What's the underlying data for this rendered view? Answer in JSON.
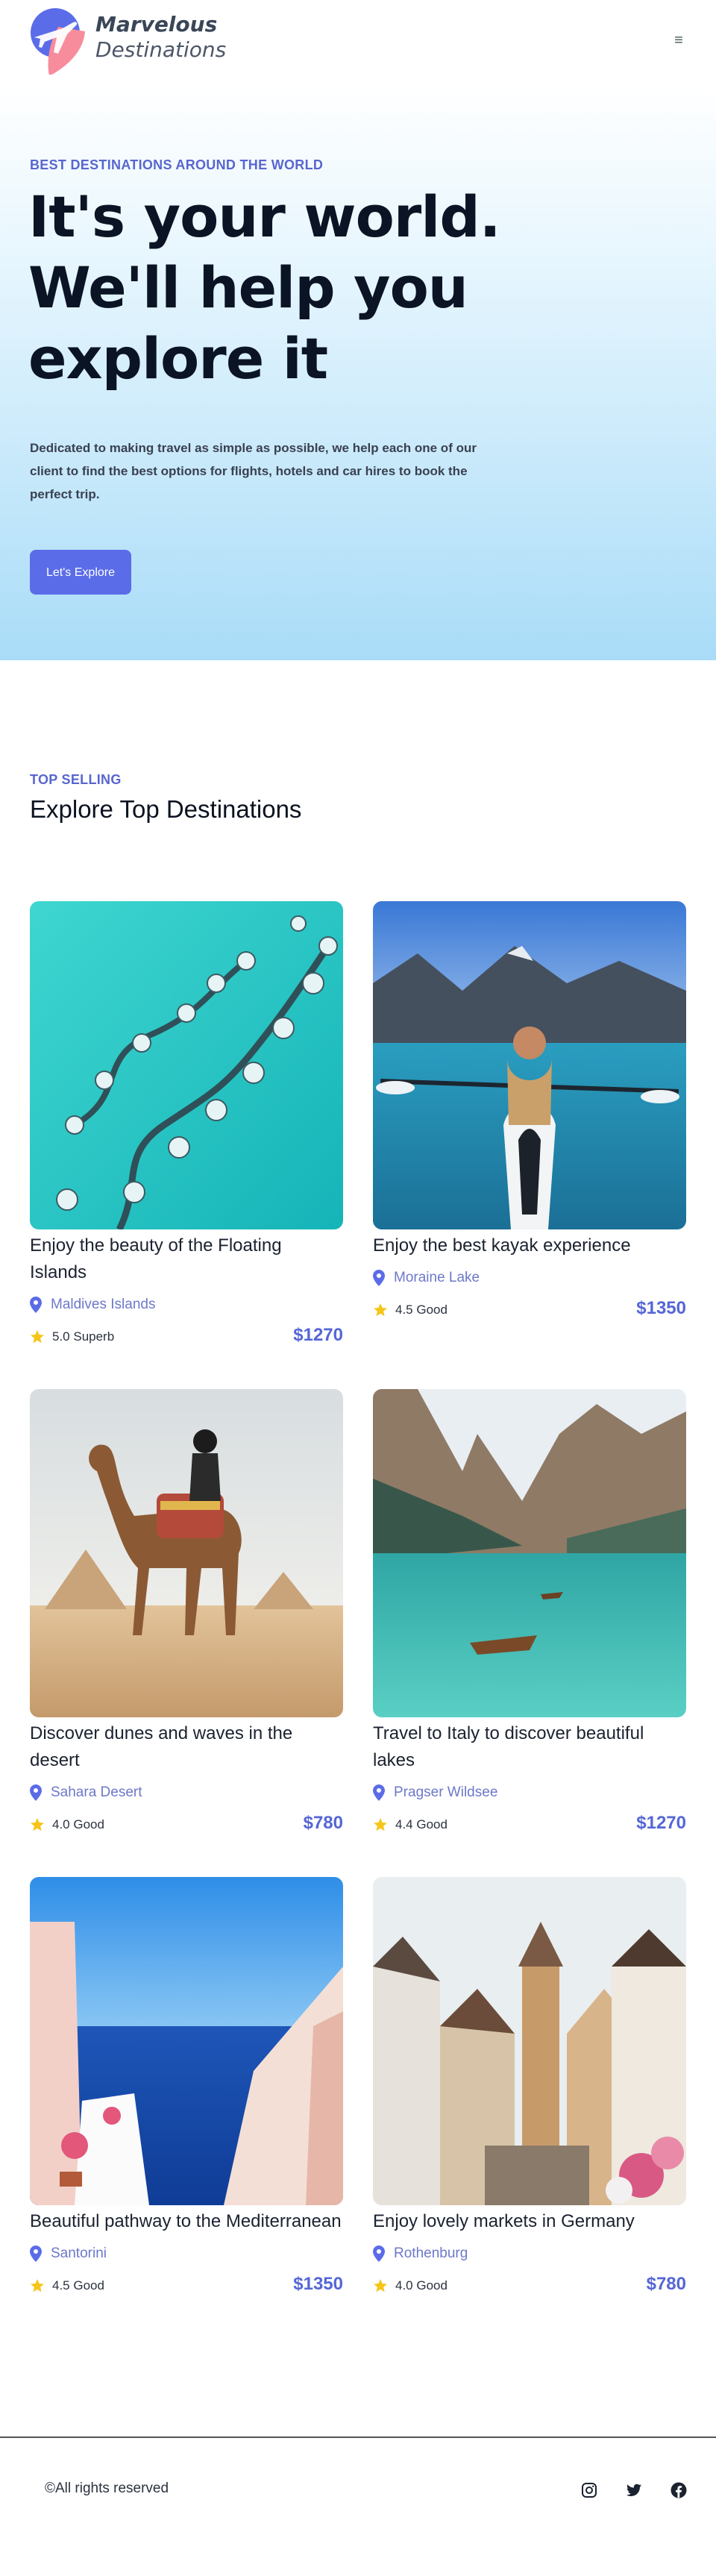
{
  "brand": {
    "line1": "Marvelous",
    "line2": "Destinations",
    "colors": {
      "primary": "#5b6ce8",
      "accent_pink": "#f78d9c",
      "price": "#5566d6"
    }
  },
  "header": {
    "menu_icon": "hamburger-icon",
    "menu_glyph": "≡"
  },
  "hero": {
    "eyebrow": "BEST DESTINATIONS AROUND THE WORLD",
    "title_lines": [
      "It's your world.",
      "We'll help you",
      "explore it"
    ],
    "description": "Dedicated to making travel as simple as possible, we help each one of our client to find the best options for flights, hotels and car hires to book the perfect trip.",
    "cta_label": "Let's Explore"
  },
  "top_selling": {
    "eyebrow": "TOP SELLING",
    "title": "Explore Top Destinations",
    "cards": [
      {
        "title": "Enjoy the beauty of the Floating Islands",
        "location": "Maldives Islands",
        "rating": "5.0 Superb",
        "price": "$1270"
      },
      {
        "title": "Enjoy the best kayak experience",
        "location": "Moraine Lake",
        "rating": "4.5 Good",
        "price": "$1350"
      },
      {
        "title": "Discover dunes and waves in the desert",
        "location": "Sahara Desert",
        "rating": "4.0 Good",
        "price": "$780"
      },
      {
        "title": "Travel to Italy to discover beautiful lakes",
        "location": "Pragser Wildsee",
        "rating": "4.4 Good",
        "price": "$1270"
      },
      {
        "title": "Beautiful pathway to the Mediterranean",
        "location": "Santorini",
        "rating": "4.5 Good",
        "price": "$1350"
      },
      {
        "title": "Enjoy lovely markets in Germany",
        "location": "Rothenburg",
        "rating": "4.0 Good",
        "price": "$780"
      }
    ]
  },
  "footer": {
    "copyright": "©All rights reserved",
    "social_icons": [
      "instagram-icon",
      "twitter-icon",
      "facebook-icon"
    ]
  }
}
